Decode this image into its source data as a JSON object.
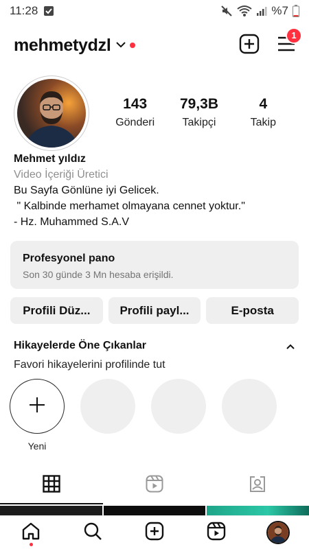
{
  "status_bar": {
    "time": "11:28",
    "battery": "%7"
  },
  "header": {
    "username": "mehmetydzl",
    "notification_count": "1"
  },
  "stats": [
    {
      "value": "143",
      "label": "Gönderi"
    },
    {
      "value": "79,3B",
      "label": "Takipçi"
    },
    {
      "value": "4",
      "label": "Takip"
    }
  ],
  "bio": {
    "name": "Mehmet yıldız",
    "category": "Video İçeriği Üretici",
    "line1": "Bu Sayfa Gönlüne iyi Gelicek.",
    "line2": " \" Kalbinde merhamet olmayana cennet yoktur.\"",
    "line3": "- Hz. Muhammed S.A.V"
  },
  "professional_panel": {
    "title": "Profesyonel pano",
    "subtitle": "Son 30 günde 3 Mn hesaba erişildi."
  },
  "buttons": {
    "edit_profile": "Profili Düz...",
    "share_profile": "Profili payl...",
    "email": "E-posta"
  },
  "highlights": {
    "title": "Hikayelerde Öne Çıkanlar",
    "subtitle": "Favori hikayelerini profilinde tut",
    "new_label": "Yeni"
  },
  "tabs": [
    "grid-icon",
    "reels-icon",
    "tagged-icon"
  ],
  "bottom_nav": [
    "home-icon",
    "search-icon",
    "create-icon",
    "reels-icon",
    "profile-avatar"
  ],
  "colors": {
    "accent_red": "#ff3040",
    "panel_gray": "#efefef"
  }
}
